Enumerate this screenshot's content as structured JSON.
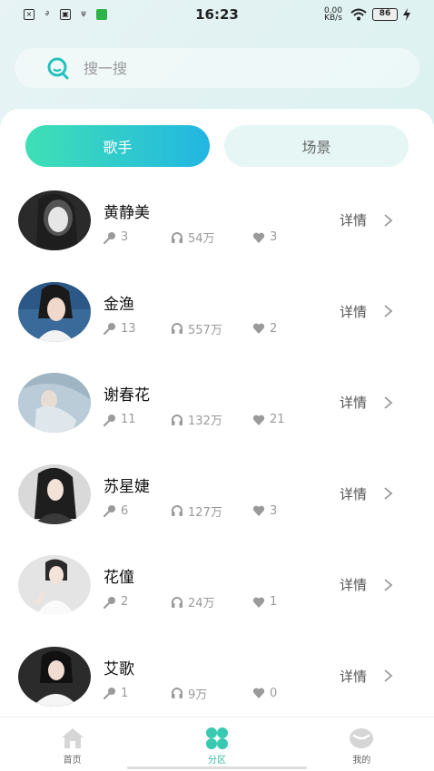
{
  "status_bar": {
    "time": "16:23",
    "network_speed": "0.00 KB/s",
    "battery": "86",
    "left_icons": [
      "x-icon",
      "link-icon",
      "nfc-icon",
      "usb-icon",
      "wechat-icon"
    ]
  },
  "search": {
    "placeholder": "搜一搜"
  },
  "tabs": [
    {
      "label": "歌手",
      "active": true
    },
    {
      "label": "场景",
      "active": false
    }
  ],
  "singers": [
    {
      "name": "黄静美",
      "songs": "3",
      "plays": "54万",
      "likes": "3",
      "detail": "详情"
    },
    {
      "name": "金渔",
      "songs": "13",
      "plays": "557万",
      "likes": "2",
      "detail": "详情"
    },
    {
      "name": "谢春花",
      "songs": "11",
      "plays": "132万",
      "likes": "21",
      "detail": "详情"
    },
    {
      "name": "苏星婕",
      "songs": "6",
      "plays": "127万",
      "likes": "3",
      "detail": "详情"
    },
    {
      "name": "花僮",
      "songs": "2",
      "plays": "24万",
      "likes": "1",
      "detail": "详情"
    },
    {
      "name": "艾歌",
      "songs": "1",
      "plays": "9万",
      "likes": "0",
      "detail": "详情"
    }
  ],
  "bottom_nav": [
    {
      "label": "首页",
      "icon": "home-icon",
      "active": false
    },
    {
      "label": "分区",
      "icon": "grid-icon",
      "active": true
    },
    {
      "label": "我的",
      "icon": "profile-icon",
      "active": false
    }
  ],
  "colors": {
    "accent_start": "#3fe0b4",
    "accent_end": "#22b6e2",
    "active_nav": "#2fb8a0"
  }
}
